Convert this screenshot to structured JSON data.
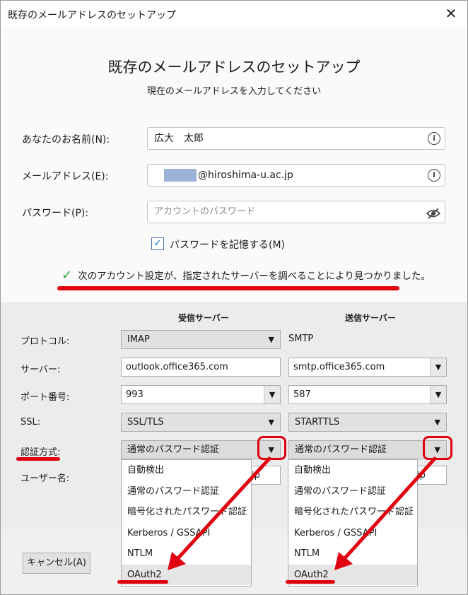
{
  "window": {
    "title": "既存のメールアドレスのセットアップ",
    "close_glyph": "✕"
  },
  "header": {
    "title": "既存のメールアドレスのセットアップ",
    "subtitle": "現在のメールアドレスを入力してください"
  },
  "form": {
    "name_label": "あなたのお名前(N):",
    "name_value": "広大　太郎",
    "email_label": "メールアドレス(E):",
    "email_value": "@hiroshima-u.ac.jp",
    "password_label": "パスワード(P):",
    "password_placeholder": "アカウントのパスワード",
    "remember_label": "パスワードを記憶する(M)",
    "remember_checked": true,
    "found_message": "次のアカウント設定が、指定されたサーバーを調べることにより見つかりました。"
  },
  "servers": {
    "incoming_header": "受信サーバー",
    "outgoing_header": "送信サーバー",
    "protocol_label": "プロトコル:",
    "protocol_in": "IMAP",
    "protocol_out": "SMTP",
    "server_label": "サーバー:",
    "server_in": "outlook.office365.com",
    "server_out": "smtp.office365.com",
    "port_label": "ポート番号:",
    "port_in": "993",
    "port_out": "587",
    "ssl_label": "SSL:",
    "ssl_in": "SSL/TLS",
    "ssl_out": "STARTTLS",
    "auth_label": "認証方式:",
    "auth_in": "通常のパスワード認証",
    "auth_out": "通常のパスワード認証",
    "username_label": "ユーザー名:",
    "username_in_suffix": "jp",
    "username_out_suffix": "jp",
    "auth_options": [
      "自動検出",
      "通常のパスワード認証",
      "暗号化されたパスワード認証",
      "Kerberos / GSSAPI",
      "NTLM",
      "OAuth2"
    ]
  },
  "footer": {
    "cancel_label": "キャンセル(A)"
  },
  "colors": {
    "annotation_red": "#e00010",
    "check_green": "#1faa3b"
  }
}
